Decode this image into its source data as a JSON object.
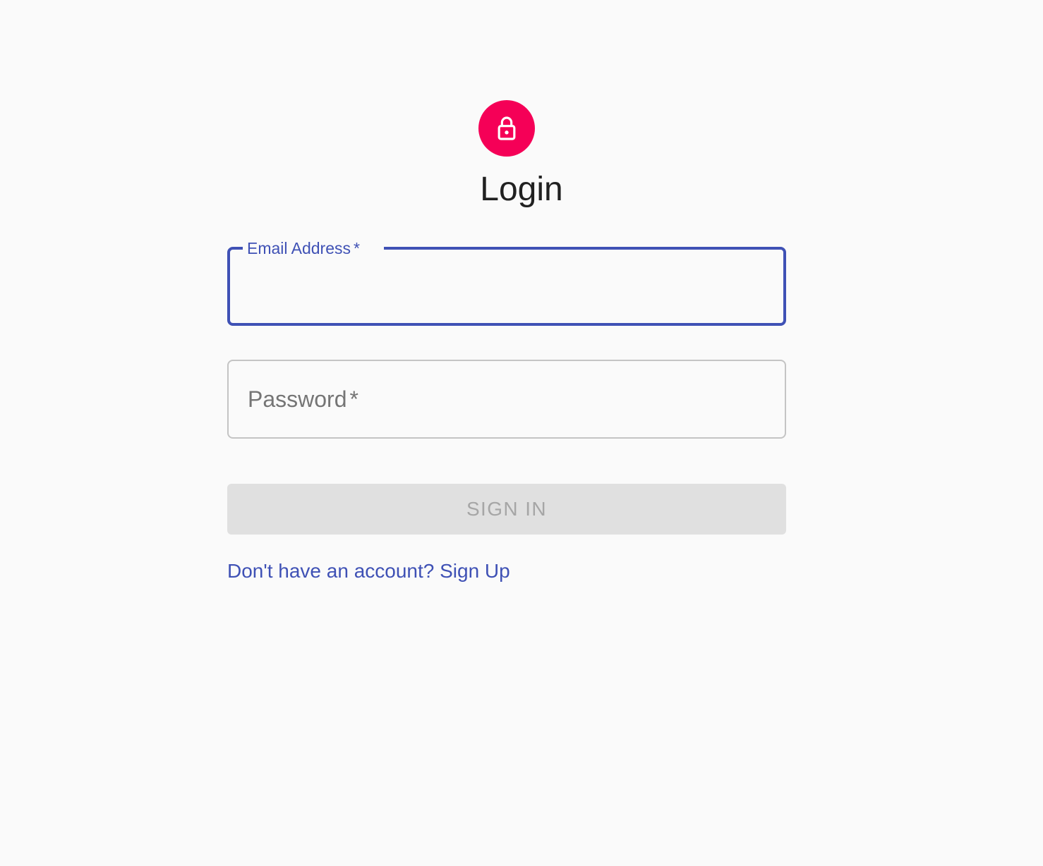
{
  "colors": {
    "background": "#fafafa",
    "avatar": "#f50057",
    "primary": "#3f51b5",
    "disabled_button_bg": "#e0e0e0",
    "disabled_button_text": "#a6a6a6"
  },
  "header": {
    "icon": "lock-icon",
    "title": "Login"
  },
  "form": {
    "email": {
      "label": "Email Address",
      "required_mark": "*",
      "value": ""
    },
    "password": {
      "label": "Password",
      "required_mark": "*",
      "value": ""
    },
    "submit_label": "SIGN IN",
    "signup_link": "Don't have an account? Sign Up"
  }
}
